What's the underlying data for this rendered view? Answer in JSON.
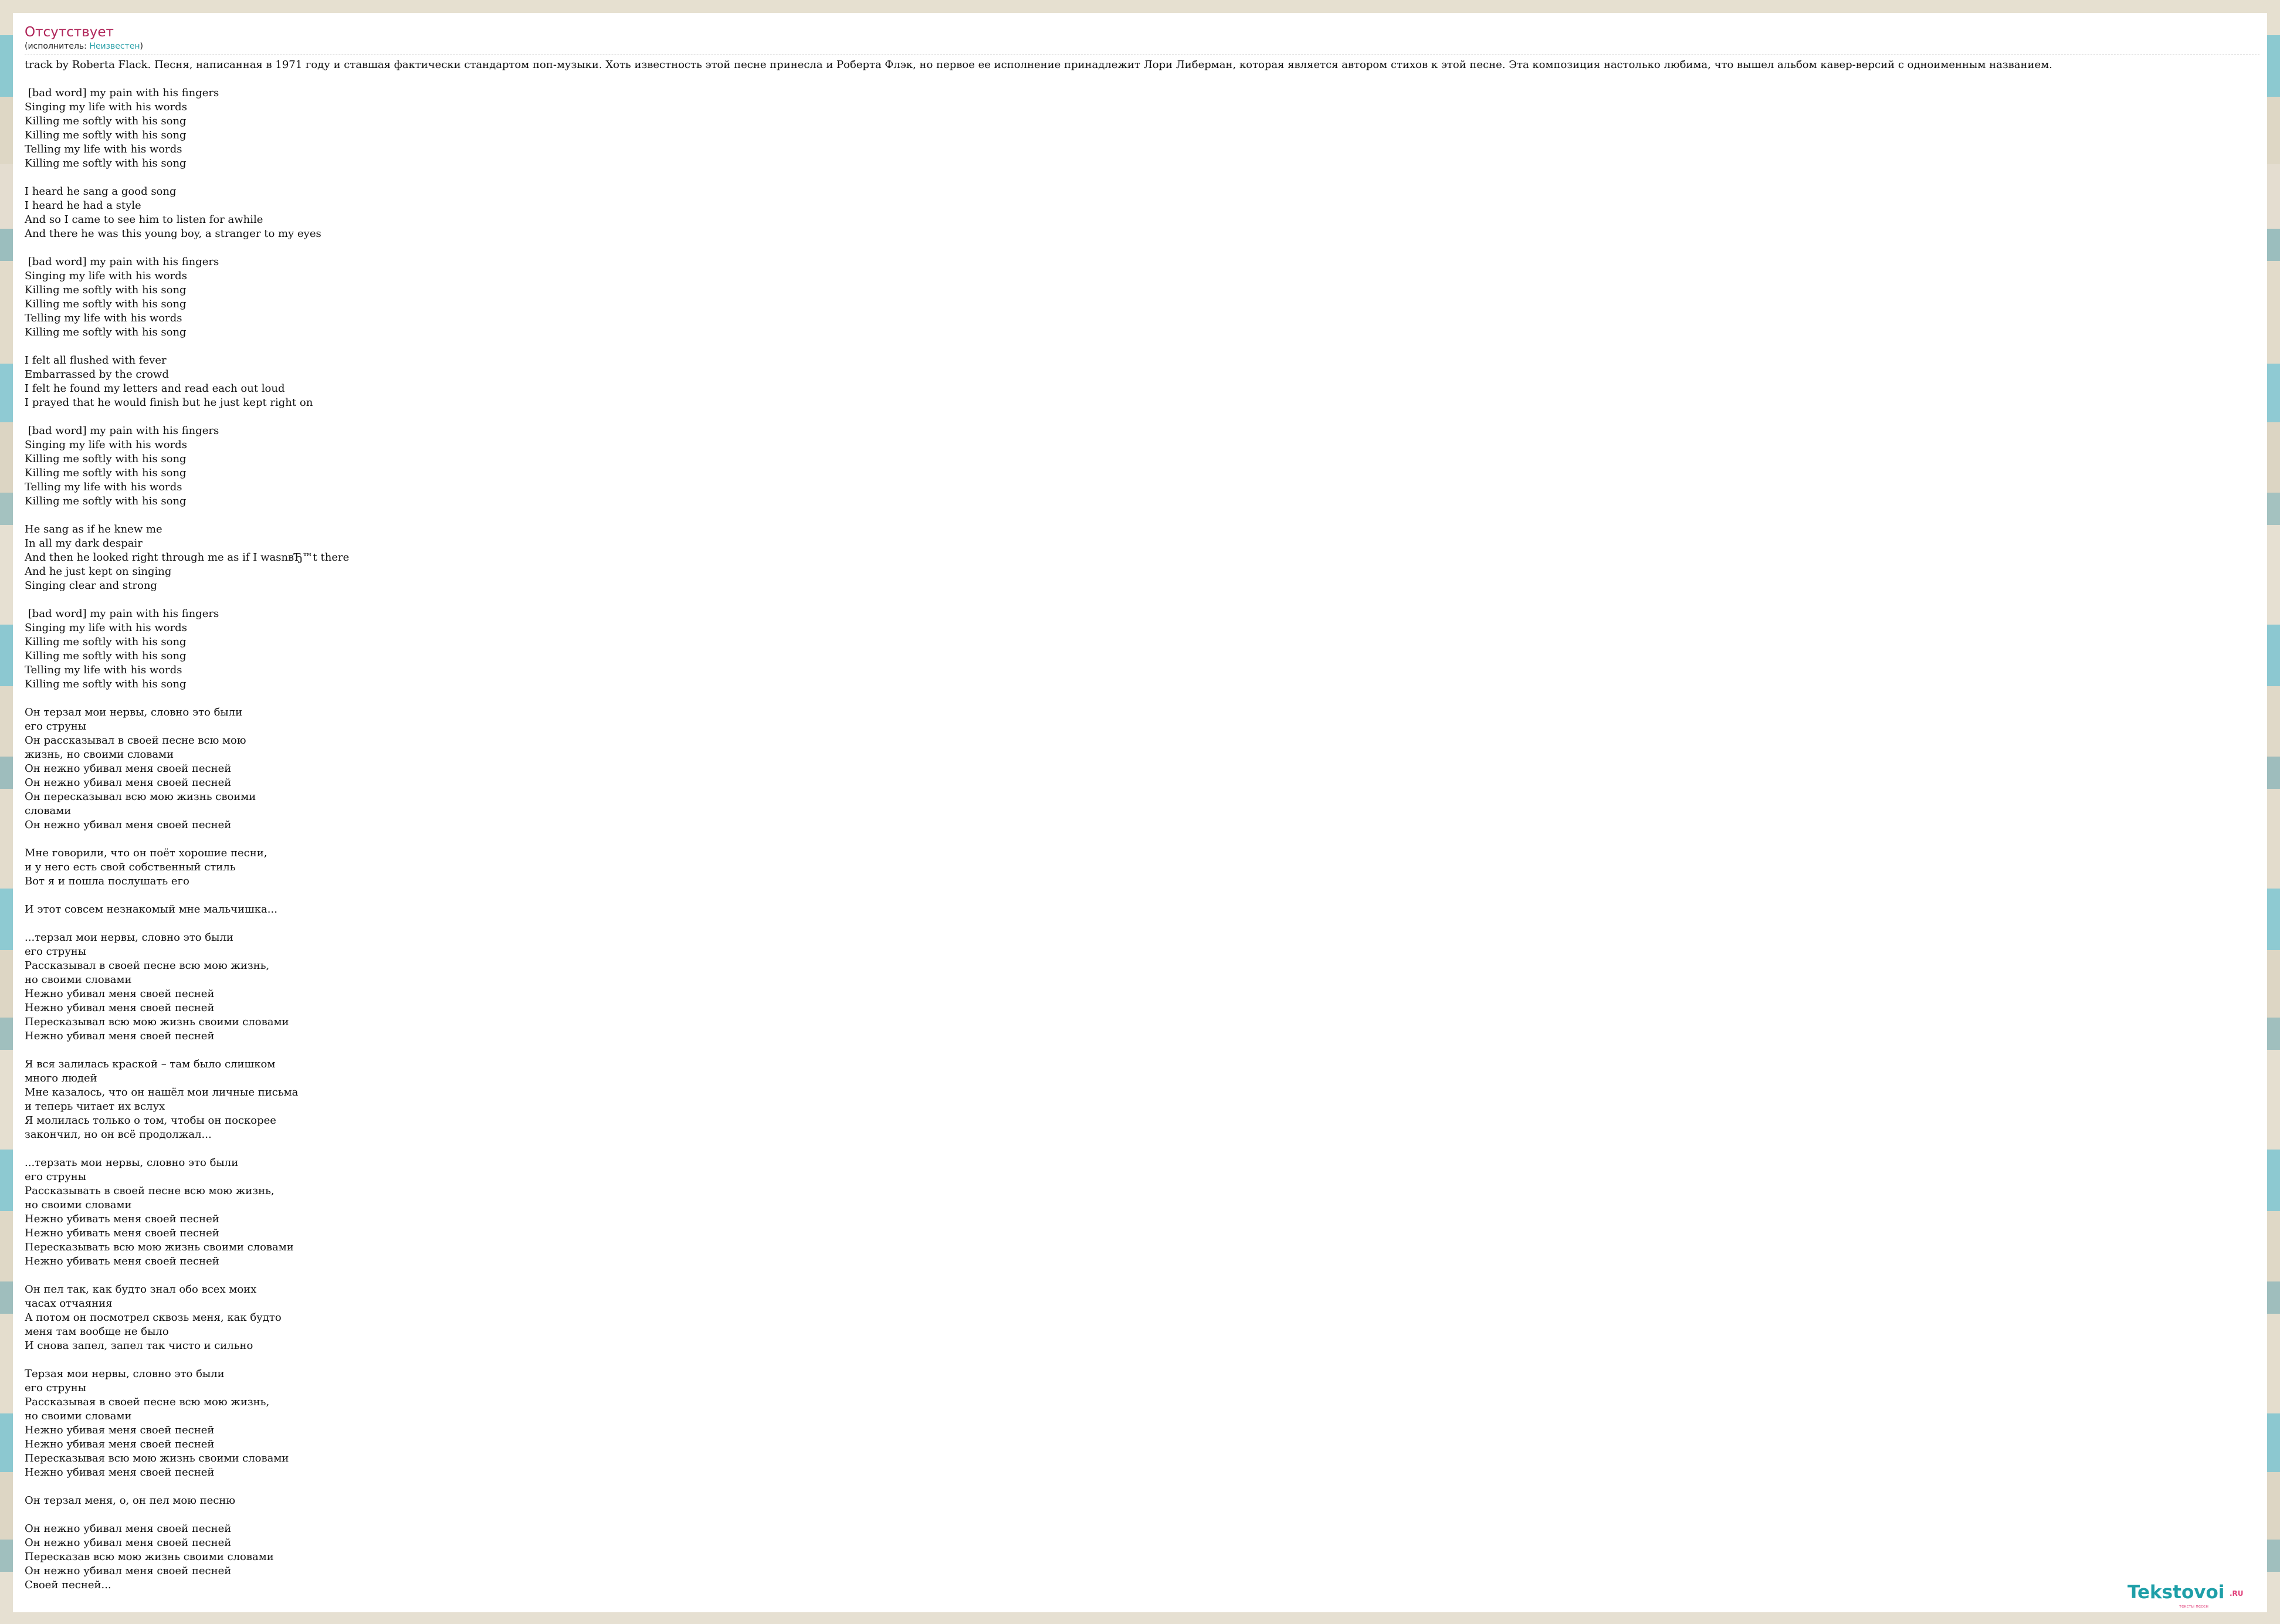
{
  "song": {
    "title": "Отсутствует",
    "performer_prefix": "(исполнитель: ",
    "performer_link": "Неизвестен",
    "performer_suffix": ")"
  },
  "description": "track by Roberta Flack. Песня, написанная в 1971 году и ставшая фактически стандартом поп-музыки. Хоть известность этой песне принесла и Роберта Флэк, но первое ее исполнение принадлежит Лори Либерман, которая является автором стихов к этой песне. Эта композиция настолько любима, что вышел альбом кавер-версий с одноименным названием.",
  "lyrics": " [bad word] my pain with his fingers\nSinging my life with his words\nKilling me softly with his song\nKilling me softly with his song\nTelling my life with his words\nKilling me softly with his song\n\nI heard he sang a good song\nI heard he had a style\nAnd so I came to see him to listen for awhile\nAnd there he was this young boy, a stranger to my eyes\n\n [bad word] my pain with his fingers\nSinging my life with his words\nKilling me softly with his song\nKilling me softly with his song\nTelling my life with his words\nKilling me softly with his song\n\nI felt all flushed with fever\nEmbarrassed by the crowd\nI felt he found my letters and read each out loud\nI prayed that he would finish but he just kept right on\n\n [bad word] my pain with his fingers\nSinging my life with his words\nKilling me softly with his song\nKilling me softly with his song\nTelling my life with his words\nKilling me softly with his song\n\nHe sang as if he knew me\nIn all my dark despair\nAnd then he looked right through me as if I wasnвЂ™t there\nAnd he just kept on singing\nSinging clear and strong\n\n [bad word] my pain with his fingers\nSinging my life with his words\nKilling me softly with his song\nKilling me softly with his song\nTelling my life with his words\nKilling me softly with his song\n\nОн терзал мои нервы, словно это были\nего струны\nОн рассказывал в своей песне всю мою\nжизнь, но своими словами\nОн нежно убивал меня своей песней\nОн нежно убивал меня своей песней\nОн пересказывал всю мою жизнь своими\nсловами\nОн нежно убивал меня своей песней\n\nМне говорили, что он поёт хорошие песни,\nи у него есть свой собственный стиль\nВот я и пошла послушать его\n\nИ этот совсем незнакомый мне мальчишка...\n\n...терзал мои нервы, словно это были\nего струны\nРассказывал в своей песне всю мою жизнь,\nно своими словами\nНежно убивал меня своей песней\nНежно убивал меня своей песней\nПересказывал всю мою жизнь своими словами\nНежно убивал меня своей песней\n\nЯ вся залилась краской – там было слишком\nмного людей\nМне казалось, что он нашёл мои личные письма\nи теперь читает их вслух\nЯ молилась только о том, чтобы он поскорее\nзакончил, но он всё продолжал...\n\n...терзать мои нервы, словно это были\nего струны\nРассказывать в своей песне всю мою жизнь,\nно своими словами\nНежно убивать меня своей песней\nНежно убивать меня своей песней\nПересказывать всю мою жизнь своими словами\nНежно убивать меня своей песней\n\nОн пел так, как будто знал обо всех моих\nчасах отчаяния\nА потом он посмотрел сквозь меня, как будто\nменя там вообще не было\nИ снова запел, запел так чисто и сильно\n\nТерзая мои нервы, словно это были\nего струны\nРассказывая в своей песне всю мою жизнь,\nно своими словами\nНежно убивая меня своей песней\nНежно убивая меня своей песней\nПересказывая всю мою жизнь своими словами\nНежно убивая меня своей песней\n\nОн терзал меня, о, он пел мою песню\n\nОн нежно убивал меня своей песней\nОн нежно убивал меня своей песней\nПересказав всю мою жизнь своими словами\nОн нежно убивал меня своей песней\nСвоей песней...",
  "logo": {
    "name": "Tekstovoi",
    "suffix": ".RU",
    "tagline": "тексты песен"
  },
  "colors": {
    "title": "#b0265a",
    "link": "#2aa0a8",
    "logo": "#1e9fa8",
    "logo_accent": "#e0407a"
  }
}
